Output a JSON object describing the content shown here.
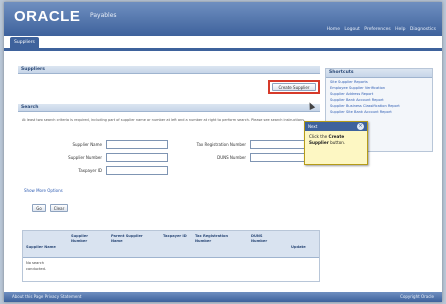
{
  "brand": {
    "logo": "ORACLE",
    "product": "Payables"
  },
  "global_links": [
    "Home",
    "Logout",
    "Preferences",
    "Help",
    "Diagnostics"
  ],
  "tabs": [
    {
      "label": "Suppliers"
    }
  ],
  "suppliers_header": "Suppliers",
  "create_supplier_button": "Create Supplier",
  "search_header": "Search",
  "search_instructions": "At least two search criteria is required, including part of supplier name or number at left and a number at right to perform search. Please see search instructions.",
  "fields": {
    "supplier_name": "Supplier Name",
    "supplier_number": "Supplier Number",
    "taxpayer_id": "Taxpayer ID",
    "tax_registration_number": "Tax Registration Number",
    "duns_number": "DUNS Number"
  },
  "show_more_link": "Show More Options",
  "go_button": "Go",
  "clear_button": "Clear",
  "table": {
    "columns": [
      "Supplier Name",
      "Supplier Number",
      "Parent Supplier Name",
      "Taxpayer ID",
      "Tax Registration Number",
      "DUNS Number",
      "Update"
    ],
    "rows": [
      "No search",
      "conducted."
    ]
  },
  "side_panel": {
    "title": "Shortcuts",
    "items": [
      "Site Supplier Reports",
      "Employee Supplier Verification",
      "Supplier Address Report",
      "Supplier Bank Account Report",
      "Supplier Business Classification Report",
      "Supplier Site Bank Account Report"
    ]
  },
  "callout": {
    "title": "Next",
    "text_before": "Click the ",
    "text_bold": "Create Supplier",
    "text_after": " button."
  },
  "footer": {
    "left": "About this Page  Privacy Statement",
    "right": "Copyright Oracle"
  }
}
